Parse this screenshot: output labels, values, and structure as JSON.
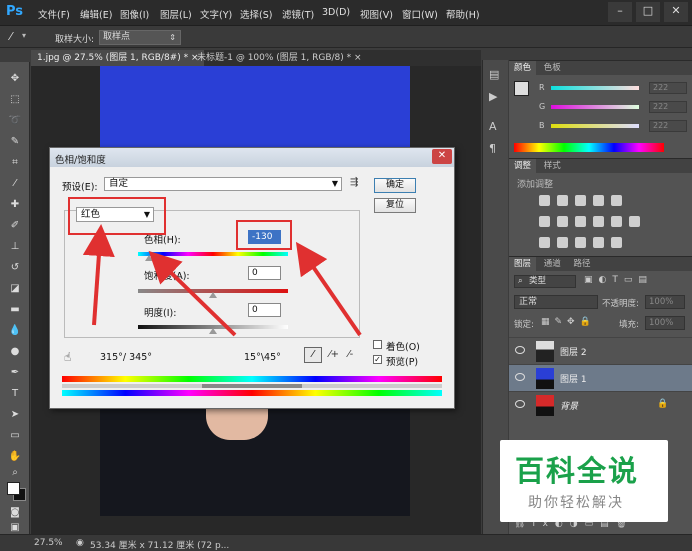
{
  "app": {
    "logo": "Ps"
  },
  "menu": [
    "文件(F)",
    "编辑(E)",
    "图像(I)",
    "图层(L)",
    "文字(Y)",
    "选择(S)",
    "滤镜(T)",
    "3D(D)",
    "视图(V)",
    "窗口(W)",
    "帮助(H)"
  ],
  "window_controls": {
    "minimize": "–",
    "maximize": "□",
    "close": "✕"
  },
  "options_bar": {
    "sample_size_label": "取样大小:",
    "sample_size_value": "取样点"
  },
  "doc_tabs": [
    "1.jpg @ 27.5% (图层 1, RGB/8#) * ×",
    "未标题-1 @ 100% (图层 1, RGB/8) * ×"
  ],
  "status_bar": {
    "zoom": "27.5%",
    "doc_info": "53.34 厘米 x 71.12 厘米 (72 p..."
  },
  "color_panel": {
    "tabs": [
      "颜色",
      "色板"
    ],
    "channels": [
      {
        "label": "R",
        "value": "222"
      },
      {
        "label": "G",
        "value": "222"
      },
      {
        "label": "B",
        "value": "222"
      }
    ]
  },
  "adjust_panel": {
    "tabs": [
      "调整",
      "样式"
    ],
    "title": "添加调整"
  },
  "layers_panel": {
    "tabs": [
      "图层",
      "通道",
      "路径"
    ],
    "kind_label": "类型",
    "blend_mode": "正常",
    "opacity_label": "不透明度:",
    "opacity_value": "100%",
    "lock_label": "锁定:",
    "fill_label": "填充:",
    "fill_value": "100%",
    "layers": [
      {
        "name": "图层 2",
        "active": false
      },
      {
        "name": "图层 1",
        "active": true
      },
      {
        "name": "背景",
        "active": false
      }
    ]
  },
  "dialog": {
    "title": "色相/饱和度",
    "close": "✕",
    "preset_label": "预设(E):",
    "preset_value": "自定",
    "ok": "确定",
    "reset": "复位",
    "channel_value": "红色",
    "hue_label": "色相(H):",
    "hue_value": "-130",
    "hue_level": 0.07,
    "saturation_label": "饱和度(A):",
    "saturation_value": "0",
    "lightness_label": "明度(I):",
    "lightness_value": "0",
    "range_left": "315°/ 345°",
    "range_right": "15°\\45°",
    "colorize_label": "着色(O)",
    "preview_label": "预览(P)",
    "preview_checked": "✓"
  },
  "watermark": {
    "title": "百科全说",
    "subtitle": "助你轻松解决"
  }
}
